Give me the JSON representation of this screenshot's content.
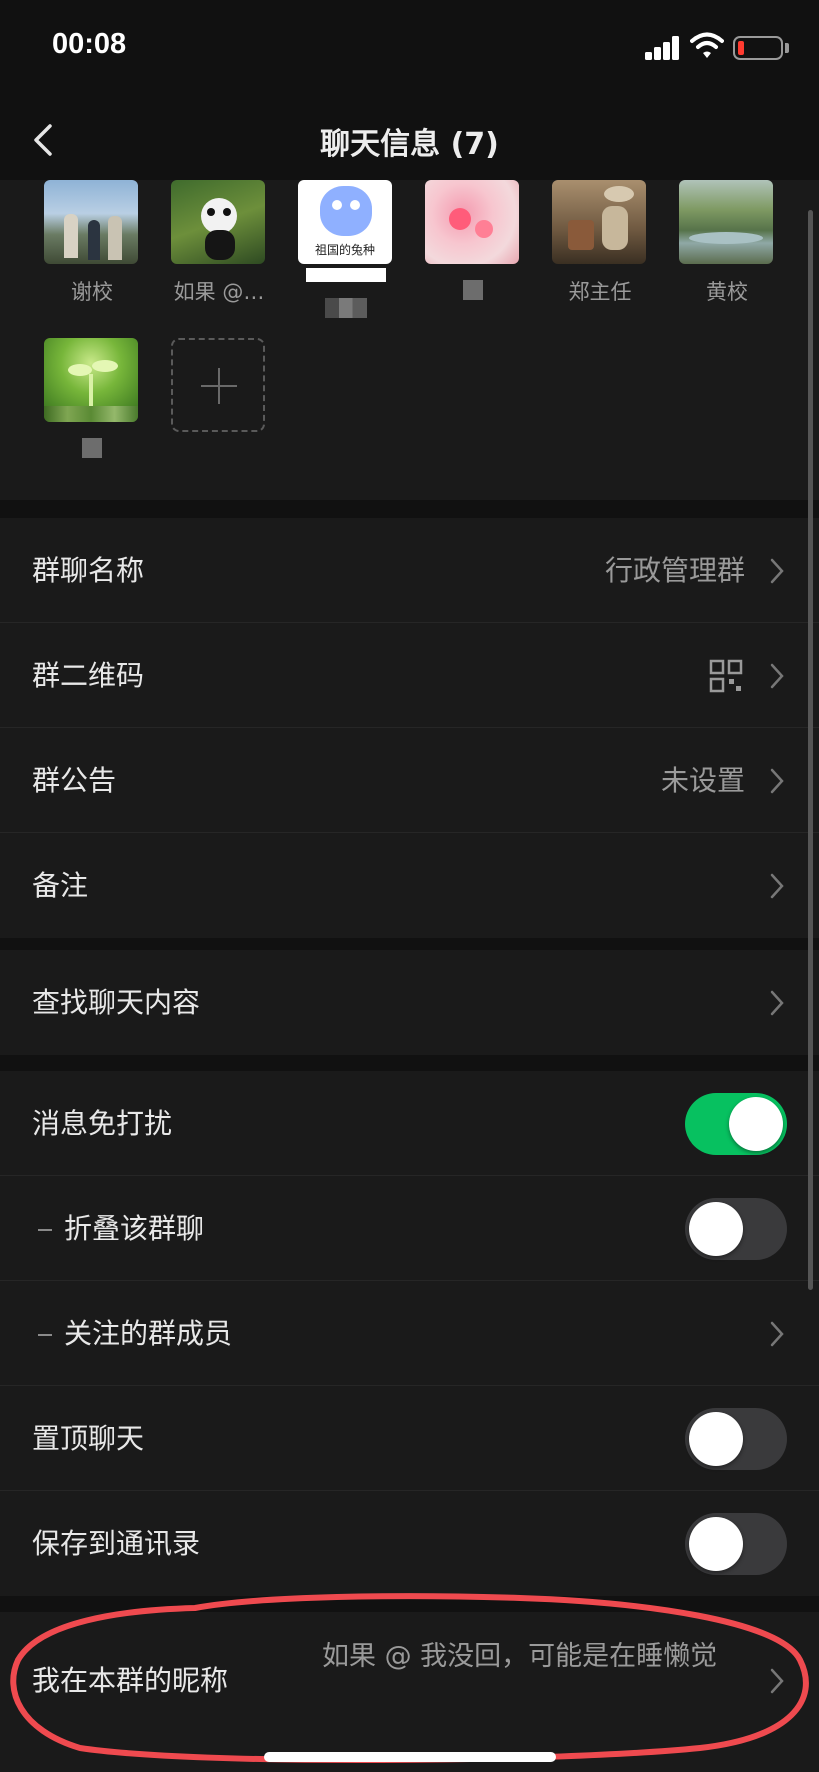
{
  "status_bar": {
    "time": "00:08"
  },
  "nav": {
    "title": "聊天信息 (7)"
  },
  "members": [
    {
      "name": "谢校"
    },
    {
      "name": "如果 @…"
    },
    {
      "name": "",
      "avatar_caption": "祖国的兔种"
    },
    {
      "name": ""
    },
    {
      "name": "郑主任"
    },
    {
      "name": "黄校"
    },
    {
      "name": ""
    }
  ],
  "settings": {
    "group_name": {
      "label": "群聊名称",
      "value": "行政管理群"
    },
    "group_qr": {
      "label": "群二维码"
    },
    "announcement": {
      "label": "群公告",
      "value": "未设置"
    },
    "remark": {
      "label": "备注"
    },
    "search_chat": {
      "label": "查找聊天内容"
    },
    "mute": {
      "label": "消息免打扰",
      "on": true
    },
    "fold": {
      "label": "折叠该群聊",
      "on": false
    },
    "followed_members": {
      "label": "关注的群成员"
    },
    "pin": {
      "label": "置顶聊天",
      "on": false
    },
    "save_contacts": {
      "label": "保存到通讯录",
      "on": false
    },
    "my_nickname": {
      "label": "我在本群的昵称",
      "value": "如果 @ 我没回，可能是在睡懒觉"
    }
  },
  "colors": {
    "accent": "#07c160",
    "highlight": "#ef4a4f",
    "background": "#111111",
    "cell": "#1a1a1a"
  }
}
